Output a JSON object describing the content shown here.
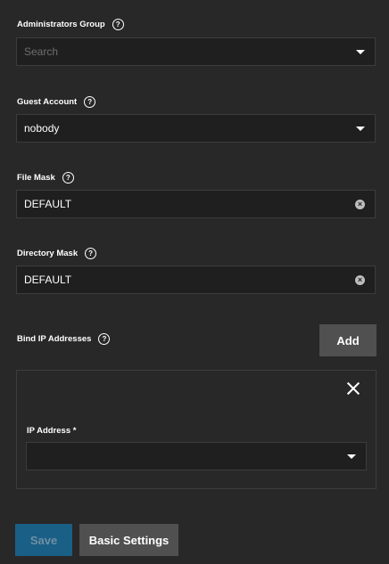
{
  "administrators_group": {
    "label": "Administrators Group",
    "placeholder": "Search"
  },
  "guest_account": {
    "label": "Guest Account",
    "value": "nobody"
  },
  "file_mask": {
    "label": "File Mask",
    "value": "DEFAULT"
  },
  "directory_mask": {
    "label": "Directory Mask",
    "value": "DEFAULT"
  },
  "bind_ip": {
    "label": "Bind IP Addresses",
    "add_label": "Add",
    "items": [
      {
        "ip_label": "IP Address *",
        "value": ""
      }
    ]
  },
  "help_glyph": "?",
  "clear_glyph": "×",
  "actions": {
    "save_label": "Save",
    "basic_settings_label": "Basic Settings"
  },
  "colors": {
    "background": "#282828",
    "input_background": "#1f1f1f",
    "button_secondary": "#505050",
    "button_primary_disabled": "#1a5f86"
  },
  "icons": {
    "help": "help-circle-icon",
    "dropdown": "chevron-down-icon",
    "clear": "clear-circle-icon",
    "close": "close-icon"
  }
}
